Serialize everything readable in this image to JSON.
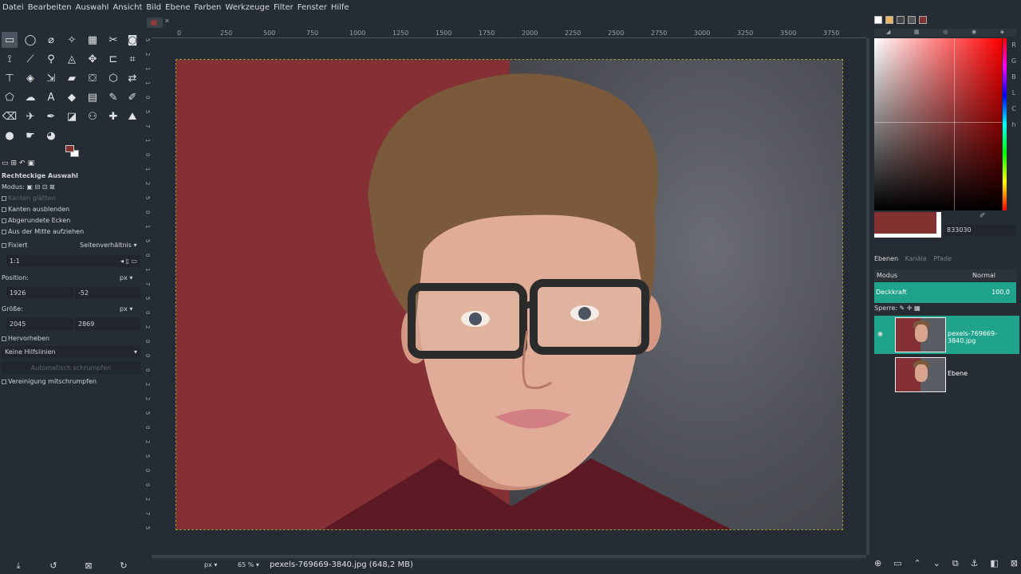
{
  "menu": [
    "Datei",
    "Bearbeiten",
    "Auswahl",
    "Ansicht",
    "Bild",
    "Ebene",
    "Farben",
    "Werkzeuge",
    "Filter",
    "Fenster",
    "Hilfe"
  ],
  "ruler_top_labels": [
    "0",
    "250",
    "500",
    "750",
    "1000",
    "1250",
    "1500",
    "1750",
    "2000",
    "2250",
    "2500",
    "2750",
    "3000",
    "3250",
    "3500",
    "3750"
  ],
  "ruler_left_labels": [
    "5",
    "2",
    "1",
    "1",
    "0",
    "5",
    "7",
    "1",
    "0",
    "1",
    "2",
    "5",
    "0",
    "1",
    "5",
    "0",
    "1",
    "7",
    "5",
    "0",
    "2",
    "0",
    "0",
    "0",
    "2",
    "2",
    "5",
    "0",
    "2",
    "5",
    "0",
    "0",
    "2",
    "7",
    "5"
  ],
  "tool_options": {
    "title": "Rechteckige Auswahl",
    "modus_label": "Modus:",
    "antialias": "Kanten glätten",
    "feather": "Kanten ausblenden",
    "rounded": "Abgerundete Ecken",
    "expand_center": "Aus der Mitte aufziehen",
    "fixed_label": "Fixiert",
    "fixed_select": "Seitenverhältnis",
    "ratio_value": "1:1",
    "position_label": "Position:",
    "position_unit": "px",
    "position_x": "1926",
    "position_y": "-52",
    "size_label": "Größe:",
    "size_unit": "px",
    "size_w": "2045",
    "size_h": "2869",
    "highlight": "Hervorheben",
    "guides_select": "Keine Hilfslinien",
    "auto_shrink": "Automatisch schrumpfen",
    "merge_shrink": "Vereinigung mitschrumpfen"
  },
  "statusbar": {
    "unit": "px",
    "zoom": "65 %",
    "text": "pexels-769669-3840.jpg (648,2 MB)"
  },
  "colors": {
    "foreground": "#833030",
    "hex_value": "833030",
    "accent": "#1fa38a",
    "channels": [
      "R",
      "G",
      "B",
      "L",
      "C",
      "h"
    ]
  },
  "layers_panel": {
    "tabs": [
      "Ebenen",
      "Kanäle",
      "Pfade"
    ],
    "mode_label": "Modus",
    "mode_value": "Normal",
    "opacity_label": "Deckkraft",
    "opacity_value": "100,0",
    "lock_label": "Sperre:",
    "layers": [
      {
        "name": "pexels-769669-3840.jpg",
        "selected": true
      },
      {
        "name": "Ebene",
        "selected": false
      }
    ]
  }
}
